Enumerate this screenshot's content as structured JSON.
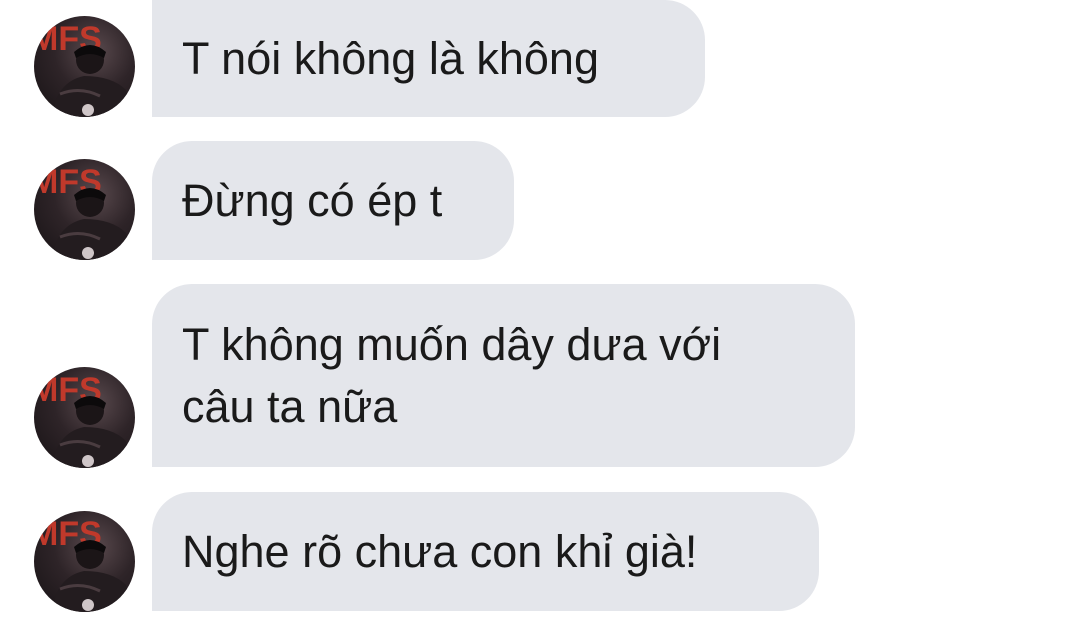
{
  "messages": [
    {
      "text": "T nói không là không"
    },
    {
      "text": "Đừng có ép t"
    },
    {
      "text": "T không muốn dây dưa với\ncâu ta nữa"
    },
    {
      "text": "Nghe rõ chưa con khỉ già!"
    }
  ],
  "avatar": {
    "alt": "profile photo",
    "letters": "MFS"
  },
  "colors": {
    "bubble": "#e4e6eb",
    "text": "#1a1a1a",
    "background": "#ffffff",
    "avatar_letters": "#c0392b"
  }
}
